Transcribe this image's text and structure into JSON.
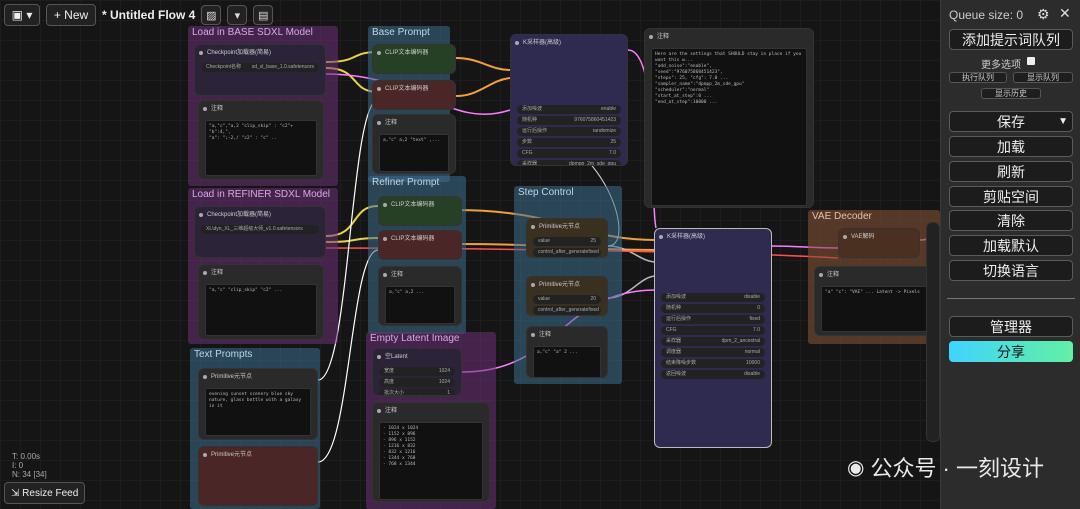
{
  "toolbar": {
    "folder_icon": "folder-icon",
    "new_label": "+ New",
    "flow_title": "* Untitled Flow 4"
  },
  "canvas_stats": {
    "line1": "T: 0.00s",
    "line2": "I: 0",
    "line3": "N: 34 [34]"
  },
  "resize_feed": "Resize Feed",
  "groups": {
    "base_sdxl": "Load in BASE SDXL Model",
    "base_prompt": "Base Prompt",
    "refiner_sdxl": "Load in REFINER SDXL Model",
    "refiner_prompt": "Refiner Prompt",
    "step_control": "Step Control",
    "empty_latent": "Empty Latent Image",
    "text_prompts": "Text Prompts",
    "vae_decoder": "VAE Decoder"
  },
  "nodes": {
    "checkpoint_base": {
      "title": "Checkpoint加载器(简易)",
      "widget_label": "Checkpoint名称",
      "widget_value": "sd_xl_base_1.0.safetensors"
    },
    "checkpoint_refiner": {
      "title": "Checkpoint加载器(简易)",
      "widget_value": "XL\\dyn_XL_三维超级大师_v1.0.safetensors"
    },
    "note_title": "注释",
    "clip_encode": "CLIP文本编码器",
    "ksampler_adv": "K采样器(高级)",
    "primitive": "Primitive元节点",
    "empty_latent_node": "空Latent",
    "vae_decode": "VAE解码",
    "steps_value": "25",
    "refine_value": "20",
    "width_value": "1024",
    "height_value": "1024",
    "batch_value": "1",
    "k1": {
      "add_noise": "enable",
      "seed": "976075860451423",
      "control": "randomize",
      "steps": "25",
      "cfg": "7.0",
      "sampler": "dpmpp_2m_sde_gpu",
      "scheduler": "normal",
      "leftover": "enable"
    },
    "k2": {
      "add_noise": "disable",
      "seed": "0",
      "control": "fixed",
      "cfg": "7.0",
      "sampler": "dpm_2_ancestral",
      "scheduler": "normal",
      "end": "10000",
      "leftover": "disable"
    },
    "w_value": "value",
    "w_control": "control_after_generate",
    "w_fixed": "fixed"
  },
  "sidebar": {
    "queue_size": "Queue size: 0",
    "add_prompt": "添加提示词队列",
    "more_options": "更多选项",
    "view_queue": "执行队列",
    "view_history_q": "显示队列",
    "view_history": "显示历史",
    "save": "保存",
    "load": "加载",
    "refresh": "刷新",
    "clipspace": "剪贴空间",
    "clear": "清除",
    "load_default": "加载默认",
    "switch_lang": "切换语言",
    "manager": "管理器",
    "share": "分享"
  },
  "watermark": "公众号 · 一刻设计",
  "colors": {
    "accent_share_start": "#3fd4ff",
    "accent_share_end": "#61f0a2",
    "group_purple": "#5a2f63",
    "group_blue": "#2e4a5e",
    "group_brown": "#5a3a2a"
  }
}
